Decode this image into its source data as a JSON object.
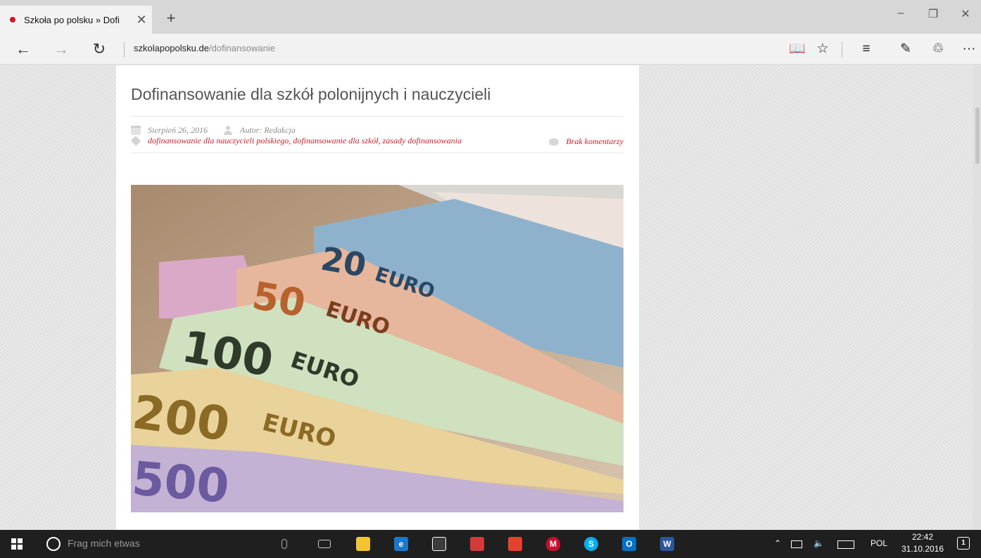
{
  "browser": {
    "tab": {
      "title": "Szkoła po polsku » Dofi",
      "close_glyph": "✕"
    },
    "new_tab_glyph": "+",
    "window_controls": {
      "minimize": "–",
      "restore": "❐",
      "close": "✕"
    },
    "nav": {
      "back": "←",
      "forward": "→",
      "refresh": "↻"
    },
    "url": {
      "domain": "szkolapopolsku.de",
      "path": "/dofinansowanie"
    },
    "toolbar": {
      "reading_view": "📖",
      "favorites": "☆",
      "hub": "≡",
      "web_note": "✎",
      "share": "♲",
      "more": "···"
    }
  },
  "article": {
    "title": "Dofinansowanie dla szkół polonijnych i nauczycieli",
    "date": "Sierpień 26, 2016",
    "author": "Autor: Redakcja",
    "tags": "dofinansowanie dla nauczycieli polskiego, dofinansowanie dla szkół, zasady dofinansowania",
    "comments": "Brak komentarzy",
    "image": {
      "banknotes": [
        {
          "denomination": "20",
          "word": "EURO"
        },
        {
          "denomination": "50",
          "word": "EURO"
        },
        {
          "denomination": "100",
          "word": "EURO"
        },
        {
          "denomination": "200",
          "word": "EURO"
        },
        {
          "denomination": "500",
          "word": ""
        }
      ]
    }
  },
  "taskbar": {
    "search_placeholder": "Frag mich etwas",
    "tray": {
      "language": "POL",
      "time": "22:42",
      "date": "31.10.2016",
      "notifications": "1"
    }
  }
}
